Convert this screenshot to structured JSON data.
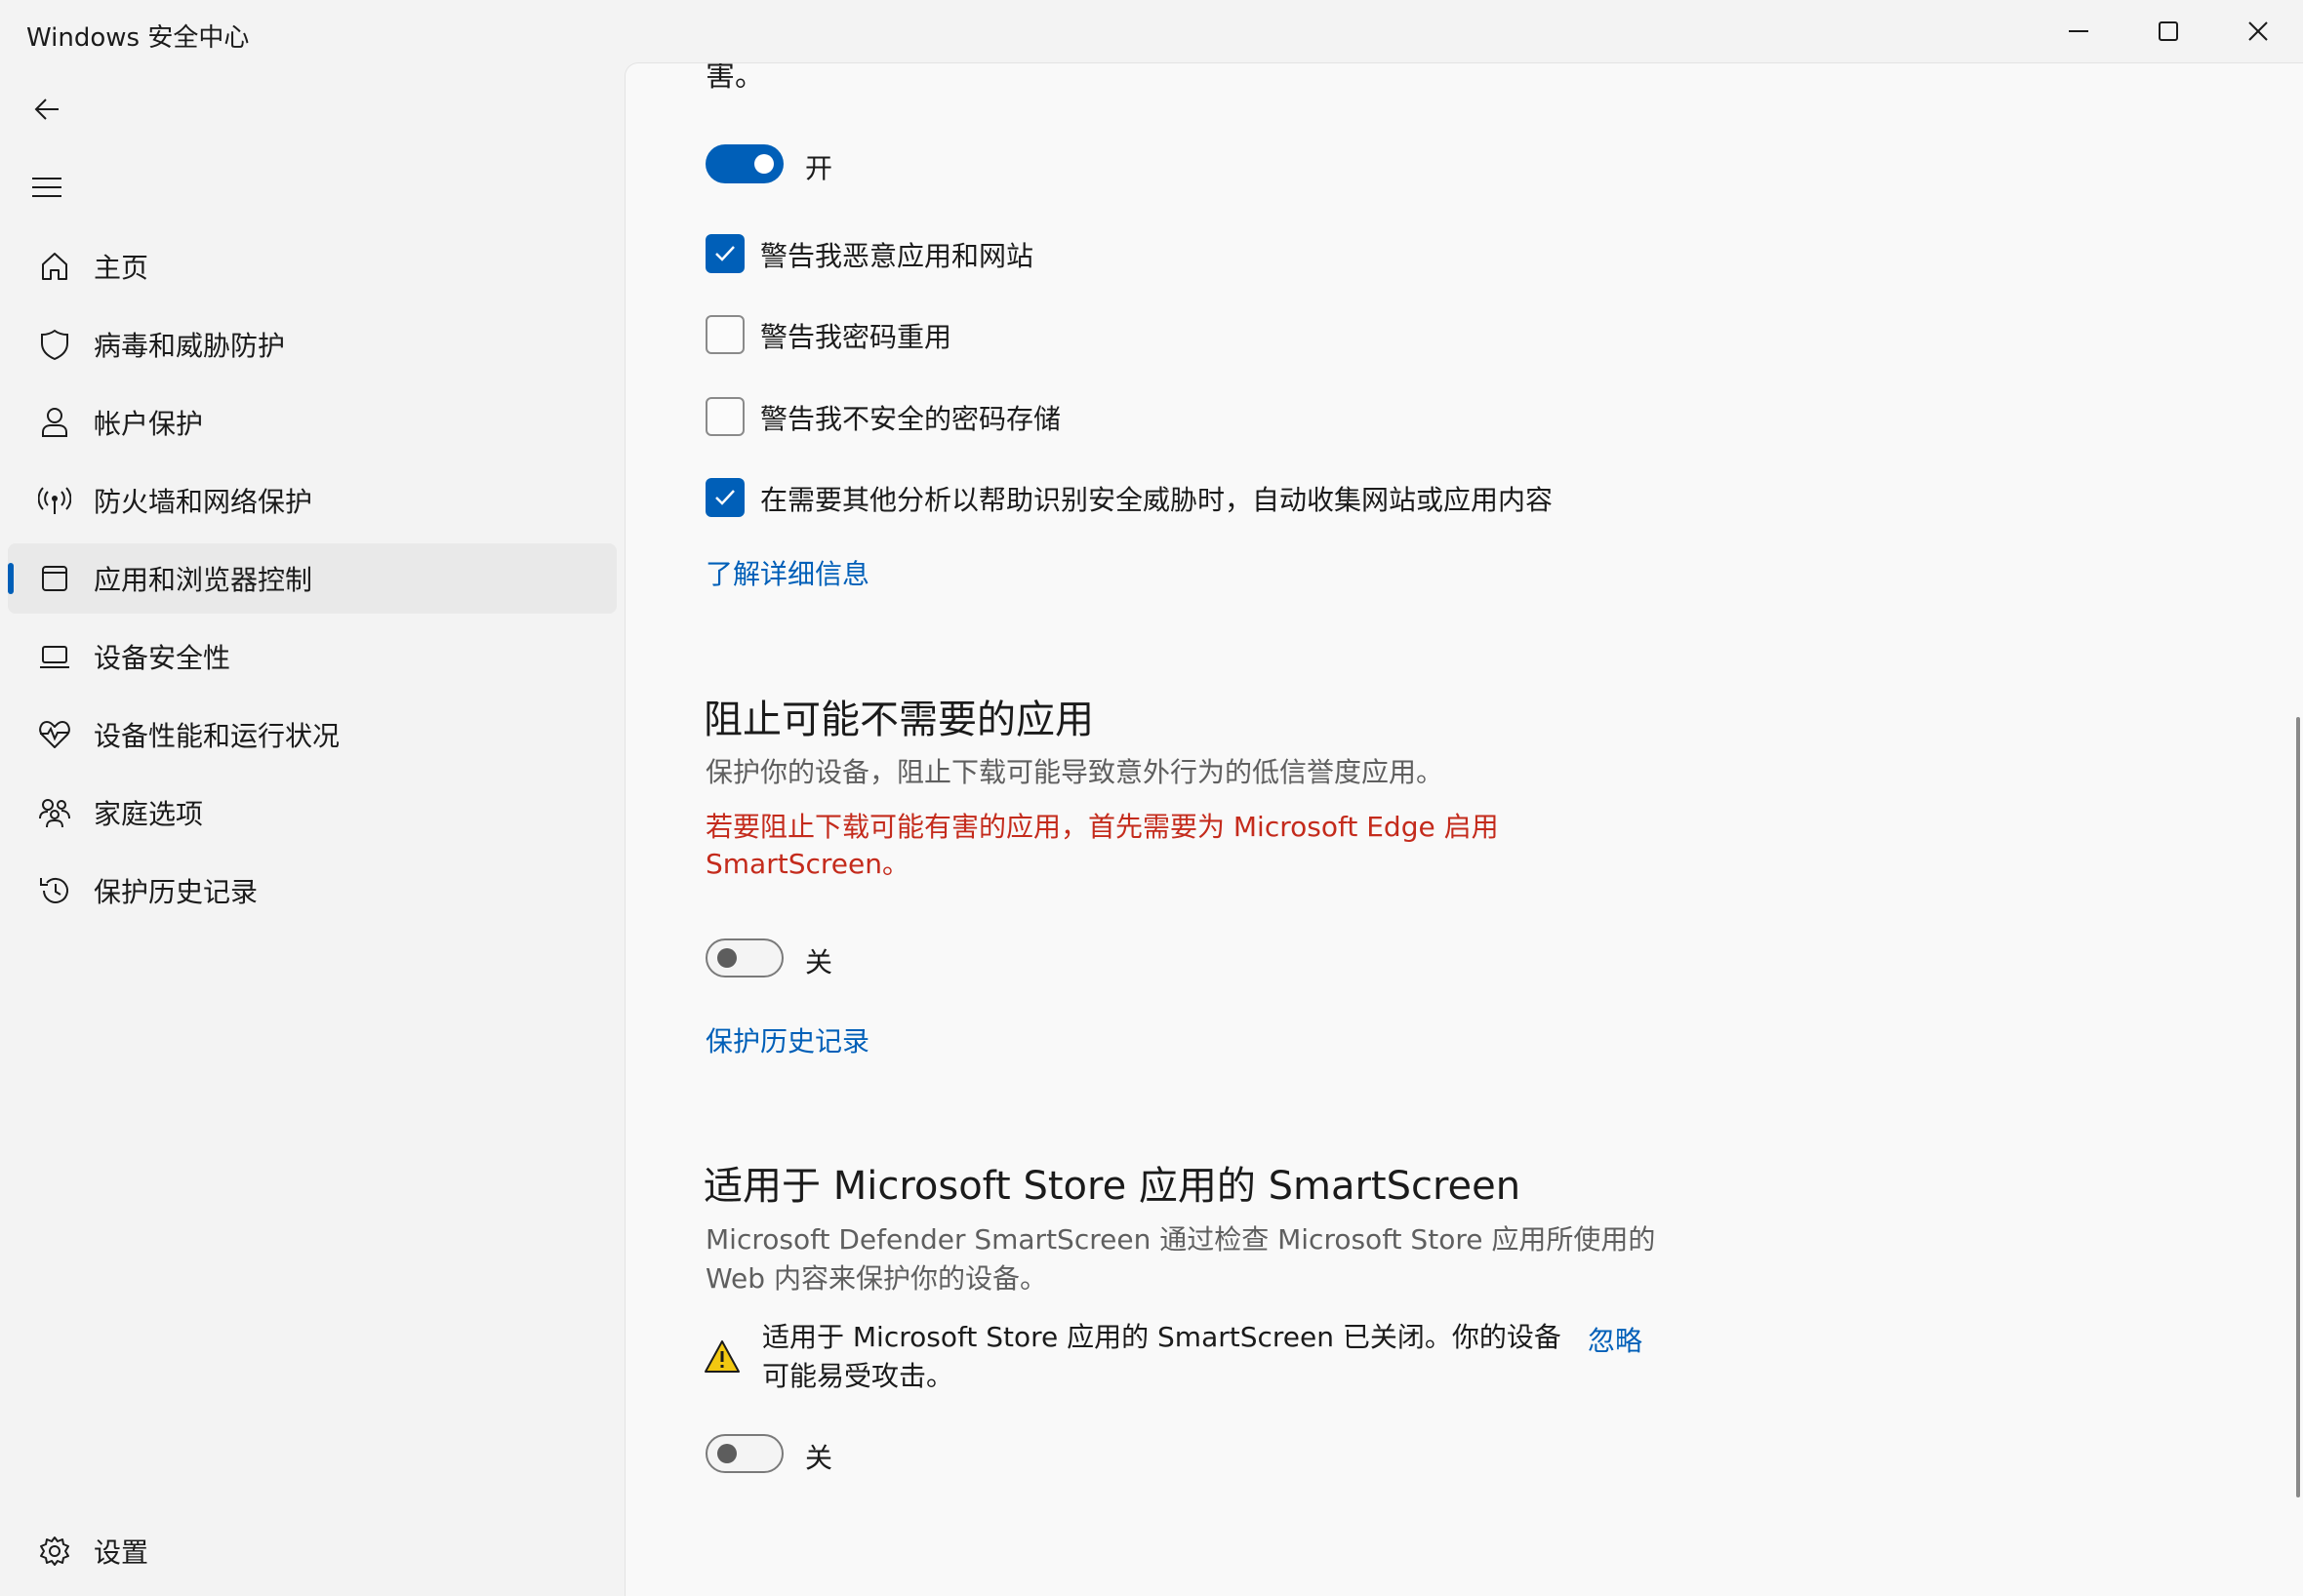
{
  "window": {
    "title": "Windows 安全中心"
  },
  "nav": {
    "items": [
      {
        "label": "主页"
      },
      {
        "label": "病毒和威胁防护"
      },
      {
        "label": "帐户保护"
      },
      {
        "label": "防火墙和网络保护"
      },
      {
        "label": "应用和浏览器控制",
        "selected": true
      },
      {
        "label": "设备安全性"
      },
      {
        "label": "设备性能和运行状况"
      },
      {
        "label": "家庭选项"
      },
      {
        "label": "保护历史记录"
      }
    ],
    "settings_label": "设置"
  },
  "content": {
    "clipped_text": "害。",
    "phishing_toggle": {
      "state": "on",
      "label": "开"
    },
    "checkboxes": [
      {
        "label": "警告我恶意应用和网站",
        "checked": true
      },
      {
        "label": "警告我密码重用",
        "checked": false
      },
      {
        "label": "警告我不安全的密码存储",
        "checked": false
      },
      {
        "label": "在需要其他分析以帮助识别安全威胁时，自动收集网站或应用内容",
        "checked": true
      }
    ],
    "learn_more_link": "了解详细信息",
    "pua": {
      "title": "阻止可能不需要的应用",
      "description": "保护你的设备，阻止下载可能导致意外行为的低信誉度应用。",
      "error": "若要阻止下载可能有害的应用，首先需要为 Microsoft Edge 启用 SmartScreen。",
      "toggle": {
        "state": "off",
        "label": "关"
      },
      "history_link": "保护历史记录"
    },
    "store": {
      "title": "适用于 Microsoft Store 应用的 SmartScreen",
      "description": "Microsoft Defender SmartScreen 通过检查 Microsoft Store 应用所使用的 Web 内容来保护你的设备。",
      "warning": "适用于 Microsoft Store 应用的 SmartScreen 已关闭。你的设备可能易受攻击。",
      "dismiss_link": "忽略",
      "toggle": {
        "state": "off",
        "label": "关"
      }
    }
  },
  "colors": {
    "accent": "#005fb8",
    "error": "#c42b1c",
    "warning": "#f2c811"
  }
}
